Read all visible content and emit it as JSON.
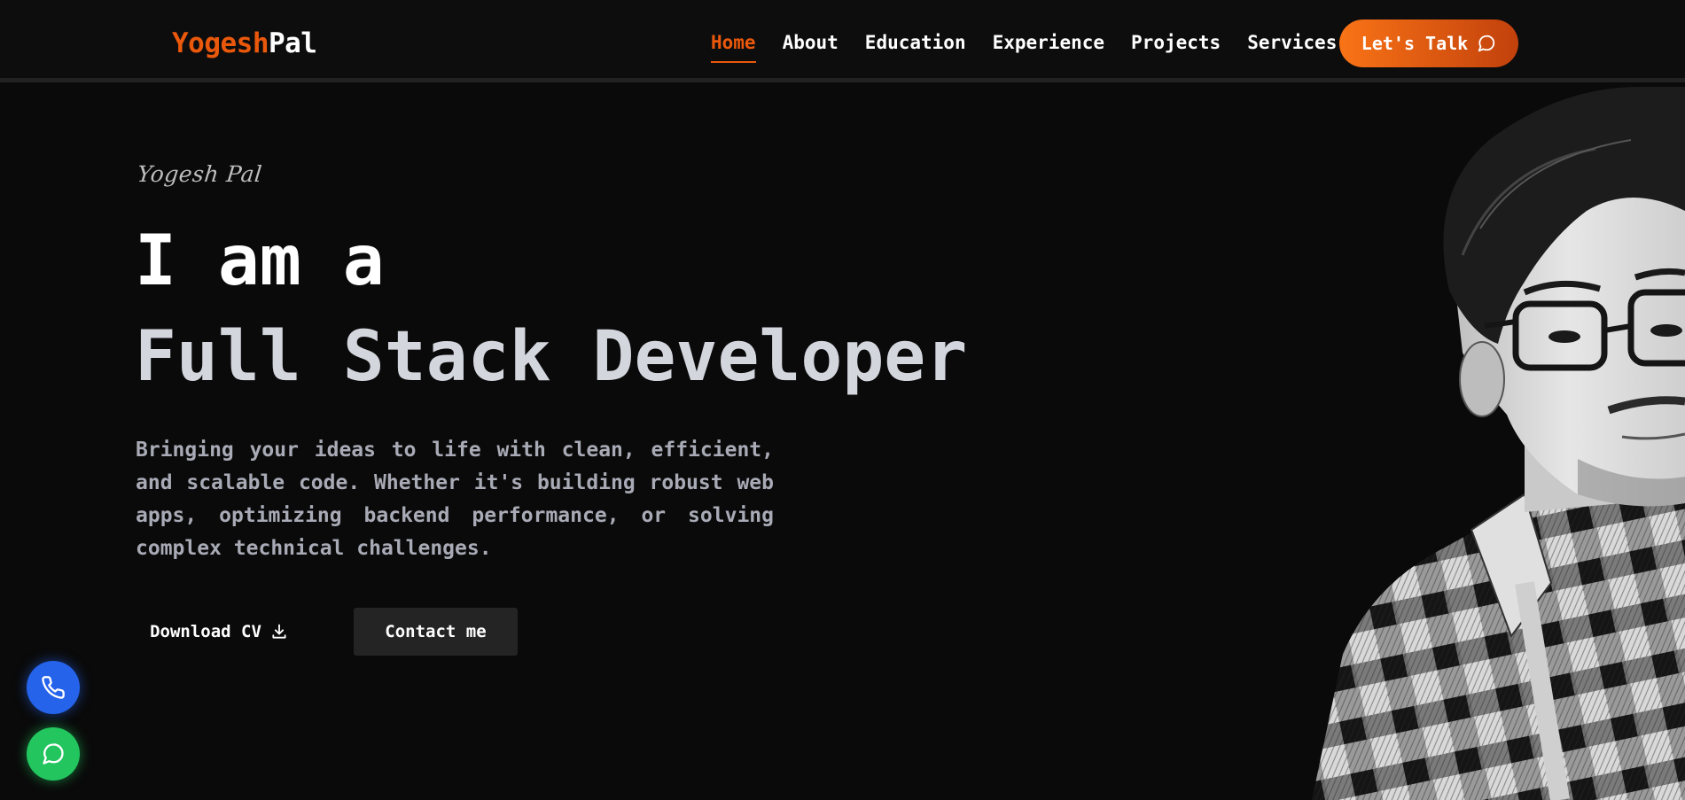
{
  "navbar": {
    "logo_first": "Yogesh",
    "logo_last": "Pal",
    "links": [
      "Home",
      "About",
      "Education",
      "Experience",
      "Projects",
      "Services"
    ],
    "active_link": "Home",
    "cta_label": "Let's Talk",
    "cta_icon": "chat-bubble-icon"
  },
  "hero": {
    "name": "Yogesh Pal",
    "line1": "I am a",
    "line2": "Full Stack Developer",
    "description": "Bringing your ideas to life with clean, efficient, and scalable code. Whether it's building robust web apps, optimizing backend performance, or solving complex technical challenges.",
    "download_cv_label": "Download CV",
    "download_icon": "download-icon",
    "contact_label": "Contact me"
  },
  "floating": {
    "phone_icon": "phone-icon",
    "whatsapp_icon": "whatsapp-icon"
  },
  "colors": {
    "accent": "#ea580c",
    "background": "#0a0a0a",
    "phone_button": "#2563eb",
    "whatsapp_button": "#22c55e"
  }
}
